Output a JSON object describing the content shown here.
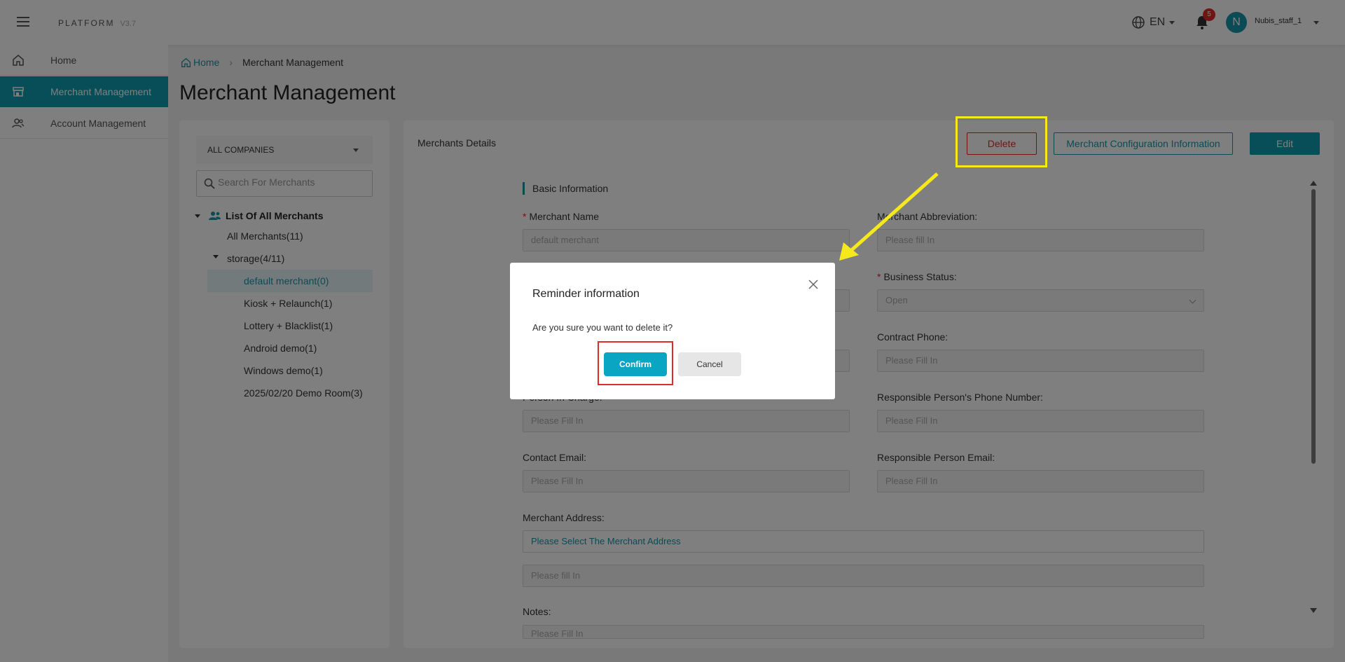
{
  "header": {
    "brand": "PLATFORM",
    "version": "V3.7",
    "language": "EN",
    "notification_count": "5",
    "avatar_initial": "N",
    "username": "Nubis_staff_1"
  },
  "sidebar": {
    "items": [
      {
        "label": "Home",
        "icon": "home-icon"
      },
      {
        "label": "Merchant Management",
        "icon": "store-icon",
        "active": true
      },
      {
        "label": "Account Management",
        "icon": "users-icon"
      }
    ]
  },
  "breadcrumb": {
    "home": "Home",
    "current": "Merchant Management"
  },
  "page_title": "Merchant Management",
  "merchants_panel": {
    "company_select": "ALL COMPANIES",
    "search_placeholder": "Search For Merchants",
    "tree_root": "List Of All Merchants",
    "all_merchants": "All Merchants(11)",
    "group": "storage(4/11)",
    "children": [
      "default merchant(0)",
      "Kiosk + Relaunch(1)",
      "Lottery + Blacklist(1)",
      "Android demo(1)",
      "Windows demo(1)",
      "2025/02/20 Demo Room(3)"
    ]
  },
  "details": {
    "heading": "Merchants Details",
    "delete_label": "Delete",
    "config_label": "Merchant Configuration Information",
    "edit_label": "Edit",
    "section_title": "Basic Information",
    "fields": {
      "merchant_name": {
        "label": "Merchant Name",
        "value": "default merchant"
      },
      "merchant_abbreviation": {
        "label": "Merchant Abbreviation:",
        "value": "Please fill In"
      },
      "business_status": {
        "label": "Business Status:",
        "value": "Open"
      },
      "contract_phone": {
        "label": "Contract Phone:",
        "value": "Please Fill In"
      },
      "person_in_charge": {
        "label": "Person In Charge:",
        "value": "Please Fill In"
      },
      "responsible_phone": {
        "label": "Responsible Person's Phone Number:",
        "value": "Please Fill In"
      },
      "contact_email": {
        "label": "Contact Email:",
        "value": "Please Fill In"
      },
      "responsible_email": {
        "label": "Responsible Person Email:",
        "value": "Please Fill In"
      },
      "merchant_address": {
        "label": "Merchant Address:",
        "value": "Please Select The Merchant Address"
      },
      "address_detail": {
        "value": "Please fill In"
      },
      "notes": {
        "label": "Notes:",
        "value": "Please Fill In"
      }
    }
  },
  "modal": {
    "title": "Reminder information",
    "message": "Are you sure you want to delete it?",
    "confirm_label": "Confirm",
    "cancel_label": "Cancel"
  },
  "colors": {
    "accent": "#0e9db1",
    "danger": "#e02b2b",
    "highlight_yellow": "#f5e81c"
  }
}
